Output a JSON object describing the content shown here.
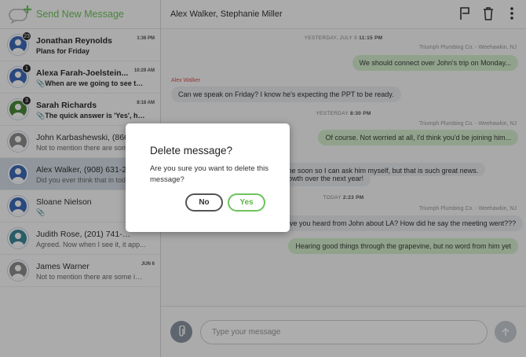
{
  "sidebar": {
    "send_new_label": "Send New Message",
    "conversations": [
      {
        "name": "Jonathan Reynolds",
        "time": "1:36 PM",
        "preview": "Plans for Friday",
        "badge": "23",
        "avatar_color": "#3d6ab8"
      },
      {
        "name": "Alexa Farah-Joelstein...",
        "time": "10:29 AM",
        "preview": "When are we going to see th...",
        "badge": "1",
        "avatar_color": "#3d6ab8"
      },
      {
        "name": "Sarah Richards",
        "time": "8:18 AM",
        "preview": "The quick answer is 'Yes', ho...",
        "badge": "3",
        "avatar_color": "#4a8a3a"
      },
      {
        "name": "John Karbashewski, (866)",
        "time": "",
        "preview": "Not to mention there are som",
        "badge": "",
        "avatar_color": "#8e8e8e"
      },
      {
        "name": "Alex Walker, (908) 631-20",
        "time": "",
        "preview": "Did you ever think that in tod",
        "badge": "",
        "avatar_color": "#3d6ab8"
      },
      {
        "name": "Sloane Nielson",
        "time": "",
        "preview": "",
        "badge": "",
        "avatar_color": "#3d6ab8"
      },
      {
        "name": "Judith Rose, (201) 741-8035...",
        "time": "",
        "preview": "Agreed. Now when I see it, it app...",
        "badge": "",
        "avatar_color": "#3d8a9a"
      },
      {
        "name": "James Warner",
        "time": "JUN 6",
        "preview": "Not to mention there are some ins...",
        "badge": "",
        "avatar_color": "#8e8e8e"
      }
    ]
  },
  "thread": {
    "recipients": "Alex Walker, Stephanie Miller",
    "day1_label": "YESTERDAY, JULY 9",
    "day1_time": "11:15 PM",
    "meta1": "Triumph Plumbing Co. - Weehawkin, NJ",
    "msg1": "We should connect over John's trip on Monday...",
    "sender2": "Alex Walker",
    "msg2": "Can we speak on Friday? I know he's expecting the PPT to be ready.",
    "day2_label": "YESTERDAY",
    "day2_time": "8:30 PM",
    "meta3": "Triumph Plumbing Co. - Weehawkin, NJ",
    "msg3": "Of course. Not worried at all, I'd think you'd be joining him...",
    "msg4a": "me soon so I can ask him myself, but that is such great news.",
    "msg4b": "rowth over the next year!",
    "day3_label": "TODAY",
    "day3_time": "2:23 PM",
    "meta5": "Triumph Plumbing Co. - Weehawkin, NJ",
    "msg5": "ave you heard from John about LA? How did he say the meeting went???",
    "msg6": "Hearing good things through the grapevine, but no word from him yet"
  },
  "composer": {
    "placeholder": "Type your message"
  },
  "dialog": {
    "title": "Delete message?",
    "body": "Are you sure you want to delete this message?",
    "no_label": "No",
    "yes_label": "Yes"
  },
  "colors": {
    "accent_green": "#6dc35c",
    "outgoing_bubble": "#d5efcd",
    "incoming_bubble": "#e9ecef",
    "sender_red": "#d9534f"
  }
}
